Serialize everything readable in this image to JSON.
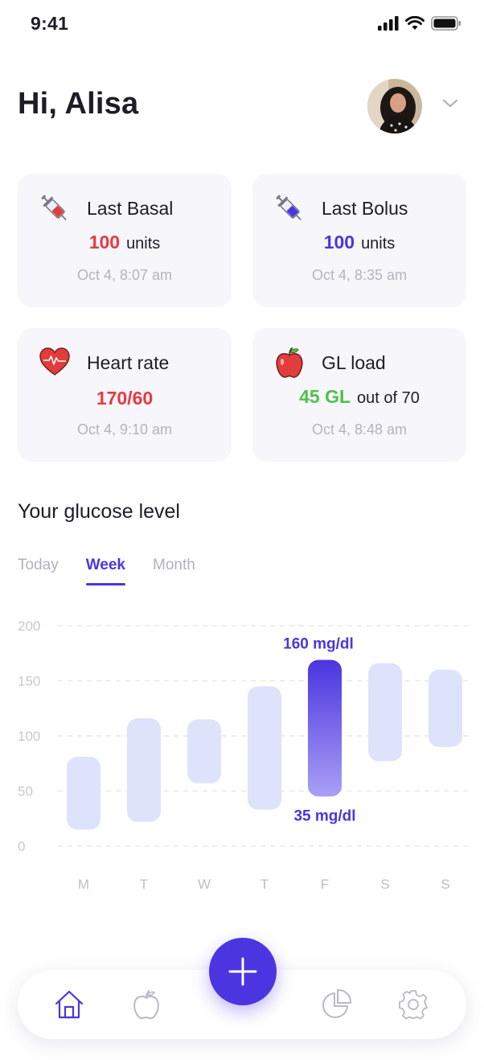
{
  "status_bar": {
    "time": "9:41"
  },
  "header": {
    "greeting": "Hi, Alisa"
  },
  "cards": {
    "basal": {
      "title": "Last Basal",
      "value": "100",
      "unit": "units",
      "timestamp": "Oct 4, 8:07 am",
      "value_color": "#e8393f"
    },
    "bolus": {
      "title": "Last Bolus",
      "value": "100",
      "unit": "units",
      "timestamp": "Oct 4, 8:35 am",
      "value_color": "#4b35e0"
    },
    "heart": {
      "title": "Heart rate",
      "value": "170/60",
      "timestamp": "Oct 4, 9:10 am",
      "value_color": "#e8393f"
    },
    "gl": {
      "title": "GL load",
      "value": "45 GL",
      "suffix": "out of 70",
      "timestamp": "Oct 4, 8:48 am",
      "value_color": "#4ec24a"
    }
  },
  "glucose": {
    "title": "Your glucose level",
    "tabs": [
      "Today",
      "Week",
      "Month"
    ],
    "active_tab": "Week"
  },
  "chart_data": {
    "type": "bar",
    "categories": [
      "M",
      "T",
      "W",
      "T",
      "F",
      "S",
      "S"
    ],
    "series": [
      {
        "low": [
          15,
          22,
          57,
          33,
          45,
          77,
          90
        ],
        "high": [
          81,
          116,
          115,
          145,
          169,
          166,
          160
        ]
      }
    ],
    "yticks": [
      "200",
      "150",
      "100",
      "50",
      "0"
    ],
    "ylim": [
      0,
      200
    ],
    "highlight_index": 4,
    "highlight_high_label": "160 mg/dl",
    "highlight_low_label": "35 mg/dl",
    "grid": "dashed",
    "colors": {
      "bar": "#dde3fa",
      "highlight_top": "#4b35e0",
      "highlight_bottom": "#a99ff5",
      "label": "#4b35e0"
    }
  },
  "nav": {
    "items": [
      "home-icon",
      "apple-icon",
      "pie-chart-icon",
      "gear-icon"
    ],
    "active": "home-icon"
  },
  "colors": {
    "accent": "#4b35e0",
    "card_bg": "#f6f6fb",
    "muted": "#b4b4c0"
  }
}
